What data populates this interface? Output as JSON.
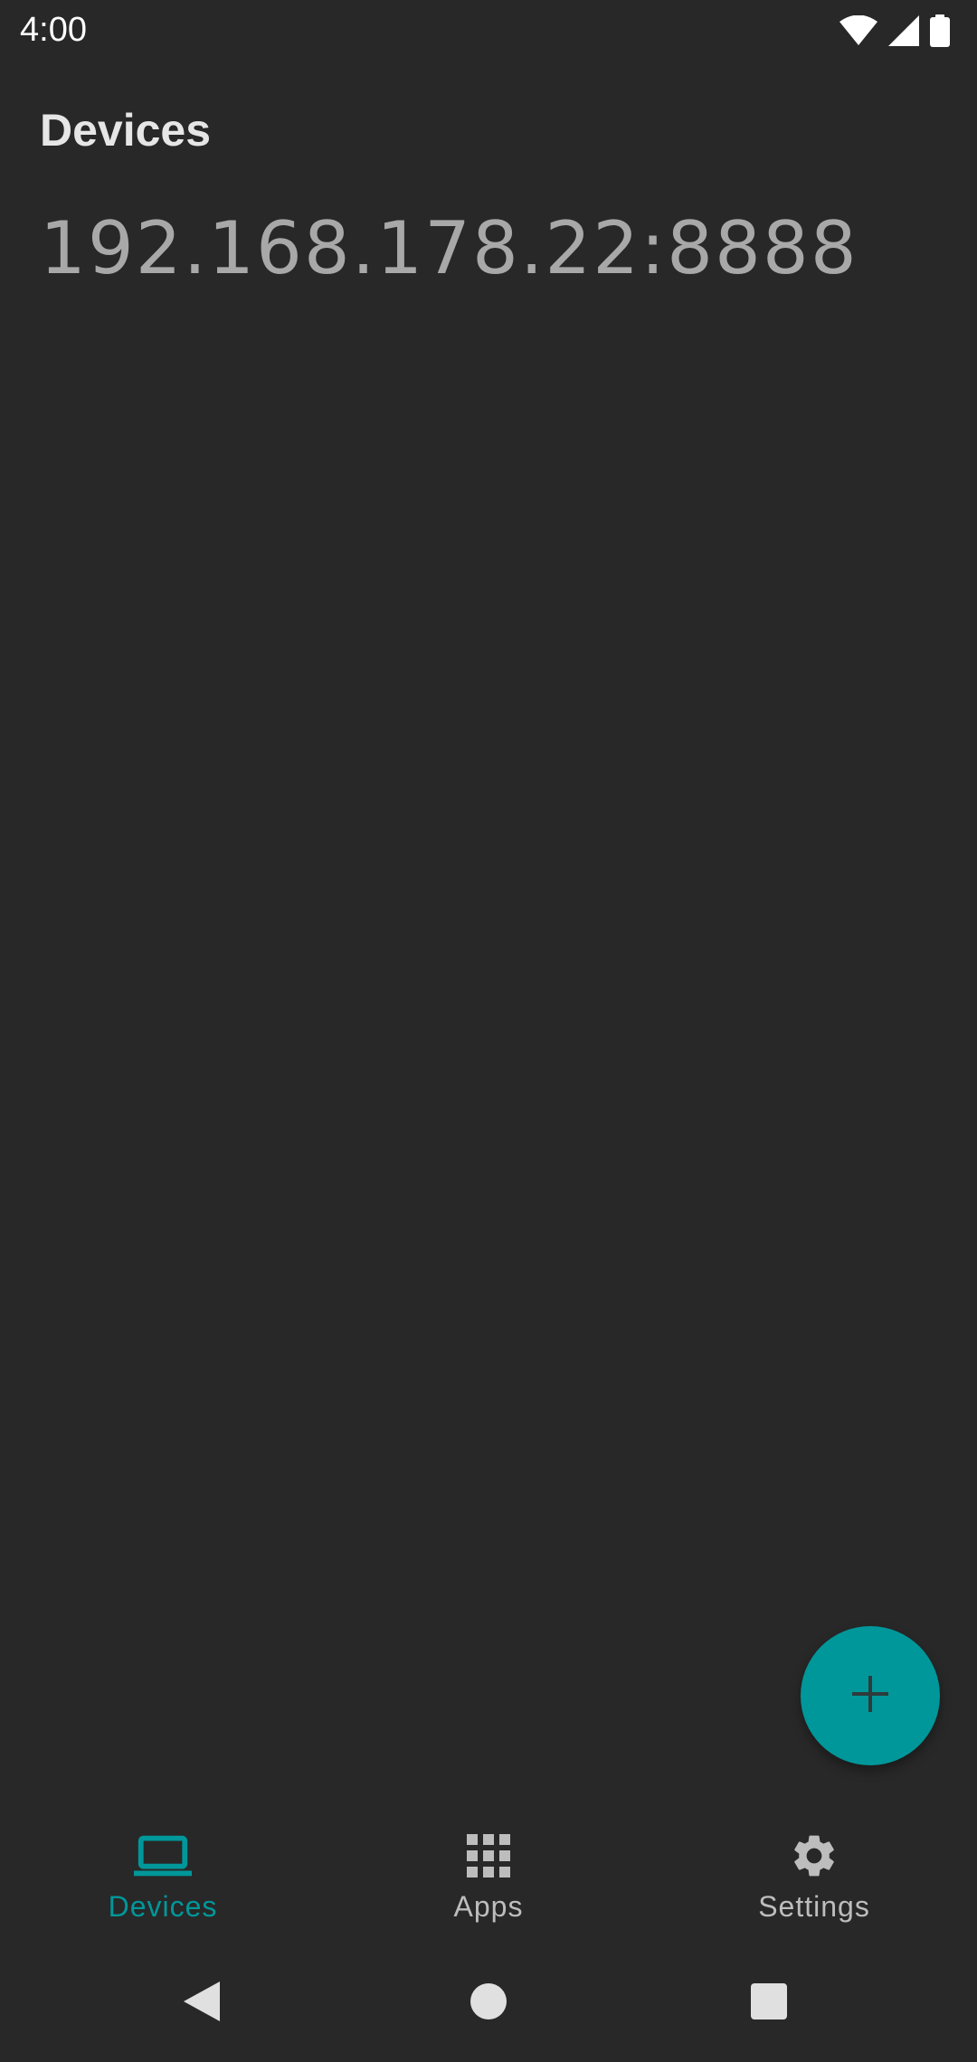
{
  "status_bar": {
    "time": "4:00",
    "icons": [
      "wifi-icon",
      "signal-icon",
      "battery-icon"
    ]
  },
  "header": {
    "title": "Devices"
  },
  "devices": [
    {
      "address": "192.168.178.22:8888"
    }
  ],
  "fab": {
    "icon": "plus-icon"
  },
  "bottom_nav": {
    "items": [
      {
        "label": "Devices",
        "icon": "laptop-icon",
        "active": true
      },
      {
        "label": "Apps",
        "icon": "apps-grid-icon",
        "active": false
      },
      {
        "label": "Settings",
        "icon": "gear-icon",
        "active": false
      }
    ]
  },
  "system_nav": {
    "icons": [
      "back-icon",
      "home-icon",
      "recents-icon"
    ]
  },
  "colors": {
    "background": "#282828",
    "accent": "#00979a",
    "text_primary": "#e6e6e6",
    "text_secondary": "#a8a8a8",
    "nav_inactive": "#bdbdbd"
  }
}
